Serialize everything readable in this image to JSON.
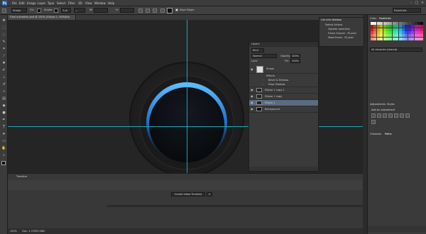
{
  "app": {
    "logo": "Ps"
  },
  "menu": [
    "File",
    "Edit",
    "Image",
    "Layer",
    "Type",
    "Select",
    "Filter",
    "3D",
    "View",
    "Window",
    "Help"
  ],
  "options": {
    "shape": "Shape",
    "fill_label": "Fill:",
    "stroke_label": "Stroke:",
    "stroke_width": "3 pt",
    "w_label": "W:",
    "h_label": "H:",
    "align_edges": "Align Edges",
    "workspace": "Essentials"
  },
  "document": {
    "tab_title": "Final animation.psd @ 100% (Ellipse 1, RGB/8#)"
  },
  "layers_panel": {
    "title": "Layers",
    "kind": "Kind",
    "blend": "Normal",
    "opacity_label": "Opacity:",
    "opacity": "100%",
    "lock_label": "Lock:",
    "fill_label": "Fill:",
    "fill": "100%",
    "rows": [
      {
        "name": "Shape",
        "indent": 0
      },
      {
        "name": "Effects",
        "indent": 1
      },
      {
        "name": "Bevel & Emboss",
        "indent": 2
      },
      {
        "name": "Drop Shadow",
        "indent": 2
      },
      {
        "name": "Ellipse 1 copy 2",
        "indent": 0
      },
      {
        "name": "Ellipse 1 copy",
        "indent": 0
      },
      {
        "name": "Ellipse 1",
        "indent": 0,
        "selected": true
      },
      {
        "name": "Background",
        "indent": 0
      }
    ]
  },
  "paths_panel": {
    "tabs": [
      "Libraries",
      "Actions"
    ],
    "rows": [
      "Default Actions",
      "Vignette (selection)",
      "Frame Channel - 50 pixel",
      "Wood Frame - 50 pixel"
    ]
  },
  "right_dock": {
    "color_tabs": [
      "Color",
      "Swatches"
    ],
    "search": "All Libraries (shared)",
    "adjustments_tabs": [
      "Adjustments",
      "Styles"
    ],
    "add_adjustment": "Add an adjustment",
    "bottom_tabs": [
      "Channels",
      "Paths"
    ]
  },
  "timeline": {
    "title": "Timeline",
    "button": "Create Video Timeline"
  },
  "status": {
    "zoom": "100%",
    "doc": "Doc: 1.37M/3.08M"
  },
  "colors": {
    "accent": "#2f6fb0",
    "guide": "#1ec8d2",
    "ring": "#3aa6ff"
  }
}
